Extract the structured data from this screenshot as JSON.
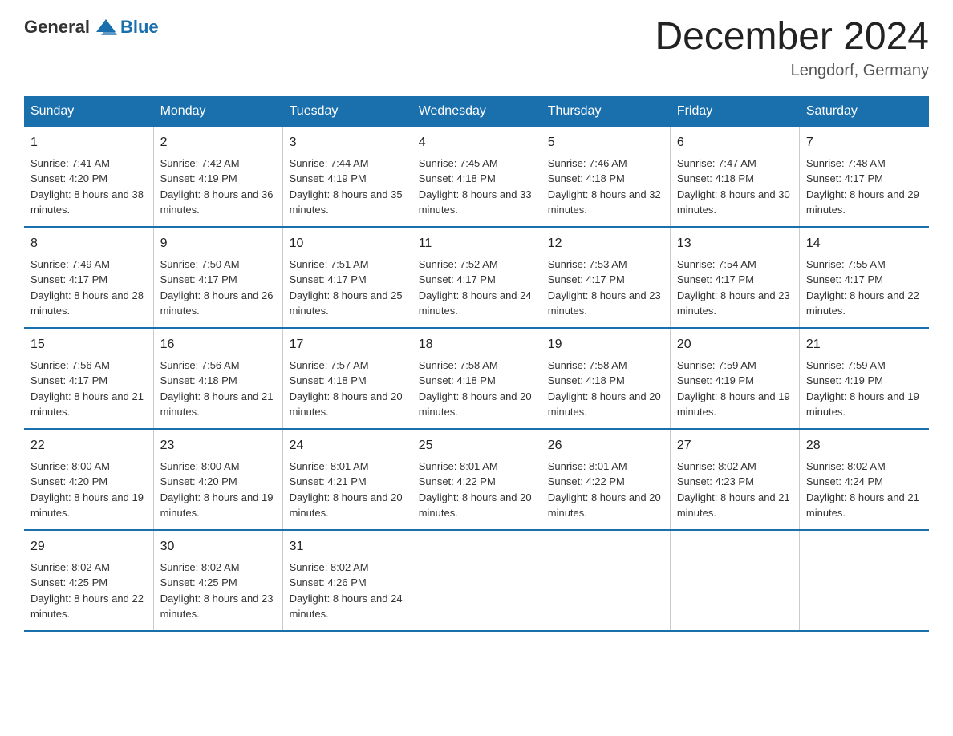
{
  "header": {
    "logo_general": "General",
    "logo_blue": "Blue",
    "title": "December 2024",
    "location": "Lengdorf, Germany"
  },
  "weekdays": [
    "Sunday",
    "Monday",
    "Tuesday",
    "Wednesday",
    "Thursday",
    "Friday",
    "Saturday"
  ],
  "weeks": [
    [
      {
        "day": "1",
        "sunrise": "7:41 AM",
        "sunset": "4:20 PM",
        "daylight": "8 hours and 38 minutes."
      },
      {
        "day": "2",
        "sunrise": "7:42 AM",
        "sunset": "4:19 PM",
        "daylight": "8 hours and 36 minutes."
      },
      {
        "day": "3",
        "sunrise": "7:44 AM",
        "sunset": "4:19 PM",
        "daylight": "8 hours and 35 minutes."
      },
      {
        "day": "4",
        "sunrise": "7:45 AM",
        "sunset": "4:18 PM",
        "daylight": "8 hours and 33 minutes."
      },
      {
        "day": "5",
        "sunrise": "7:46 AM",
        "sunset": "4:18 PM",
        "daylight": "8 hours and 32 minutes."
      },
      {
        "day": "6",
        "sunrise": "7:47 AM",
        "sunset": "4:18 PM",
        "daylight": "8 hours and 30 minutes."
      },
      {
        "day": "7",
        "sunrise": "7:48 AM",
        "sunset": "4:17 PM",
        "daylight": "8 hours and 29 minutes."
      }
    ],
    [
      {
        "day": "8",
        "sunrise": "7:49 AM",
        "sunset": "4:17 PM",
        "daylight": "8 hours and 28 minutes."
      },
      {
        "day": "9",
        "sunrise": "7:50 AM",
        "sunset": "4:17 PM",
        "daylight": "8 hours and 26 minutes."
      },
      {
        "day": "10",
        "sunrise": "7:51 AM",
        "sunset": "4:17 PM",
        "daylight": "8 hours and 25 minutes."
      },
      {
        "day": "11",
        "sunrise": "7:52 AM",
        "sunset": "4:17 PM",
        "daylight": "8 hours and 24 minutes."
      },
      {
        "day": "12",
        "sunrise": "7:53 AM",
        "sunset": "4:17 PM",
        "daylight": "8 hours and 23 minutes."
      },
      {
        "day": "13",
        "sunrise": "7:54 AM",
        "sunset": "4:17 PM",
        "daylight": "8 hours and 23 minutes."
      },
      {
        "day": "14",
        "sunrise": "7:55 AM",
        "sunset": "4:17 PM",
        "daylight": "8 hours and 22 minutes."
      }
    ],
    [
      {
        "day": "15",
        "sunrise": "7:56 AM",
        "sunset": "4:17 PM",
        "daylight": "8 hours and 21 minutes."
      },
      {
        "day": "16",
        "sunrise": "7:56 AM",
        "sunset": "4:18 PM",
        "daylight": "8 hours and 21 minutes."
      },
      {
        "day": "17",
        "sunrise": "7:57 AM",
        "sunset": "4:18 PM",
        "daylight": "8 hours and 20 minutes."
      },
      {
        "day": "18",
        "sunrise": "7:58 AM",
        "sunset": "4:18 PM",
        "daylight": "8 hours and 20 minutes."
      },
      {
        "day": "19",
        "sunrise": "7:58 AM",
        "sunset": "4:18 PM",
        "daylight": "8 hours and 20 minutes."
      },
      {
        "day": "20",
        "sunrise": "7:59 AM",
        "sunset": "4:19 PM",
        "daylight": "8 hours and 19 minutes."
      },
      {
        "day": "21",
        "sunrise": "7:59 AM",
        "sunset": "4:19 PM",
        "daylight": "8 hours and 19 minutes."
      }
    ],
    [
      {
        "day": "22",
        "sunrise": "8:00 AM",
        "sunset": "4:20 PM",
        "daylight": "8 hours and 19 minutes."
      },
      {
        "day": "23",
        "sunrise": "8:00 AM",
        "sunset": "4:20 PM",
        "daylight": "8 hours and 19 minutes."
      },
      {
        "day": "24",
        "sunrise": "8:01 AM",
        "sunset": "4:21 PM",
        "daylight": "8 hours and 20 minutes."
      },
      {
        "day": "25",
        "sunrise": "8:01 AM",
        "sunset": "4:22 PM",
        "daylight": "8 hours and 20 minutes."
      },
      {
        "day": "26",
        "sunrise": "8:01 AM",
        "sunset": "4:22 PM",
        "daylight": "8 hours and 20 minutes."
      },
      {
        "day": "27",
        "sunrise": "8:02 AM",
        "sunset": "4:23 PM",
        "daylight": "8 hours and 21 minutes."
      },
      {
        "day": "28",
        "sunrise": "8:02 AM",
        "sunset": "4:24 PM",
        "daylight": "8 hours and 21 minutes."
      }
    ],
    [
      {
        "day": "29",
        "sunrise": "8:02 AM",
        "sunset": "4:25 PM",
        "daylight": "8 hours and 22 minutes."
      },
      {
        "day": "30",
        "sunrise": "8:02 AM",
        "sunset": "4:25 PM",
        "daylight": "8 hours and 23 minutes."
      },
      {
        "day": "31",
        "sunrise": "8:02 AM",
        "sunset": "4:26 PM",
        "daylight": "8 hours and 24 minutes."
      },
      {
        "day": "",
        "sunrise": "",
        "sunset": "",
        "daylight": ""
      },
      {
        "day": "",
        "sunrise": "",
        "sunset": "",
        "daylight": ""
      },
      {
        "day": "",
        "sunrise": "",
        "sunset": "",
        "daylight": ""
      },
      {
        "day": "",
        "sunrise": "",
        "sunset": "",
        "daylight": ""
      }
    ]
  ],
  "labels": {
    "sunrise": "Sunrise: ",
    "sunset": "Sunset: ",
    "daylight": "Daylight: "
  }
}
